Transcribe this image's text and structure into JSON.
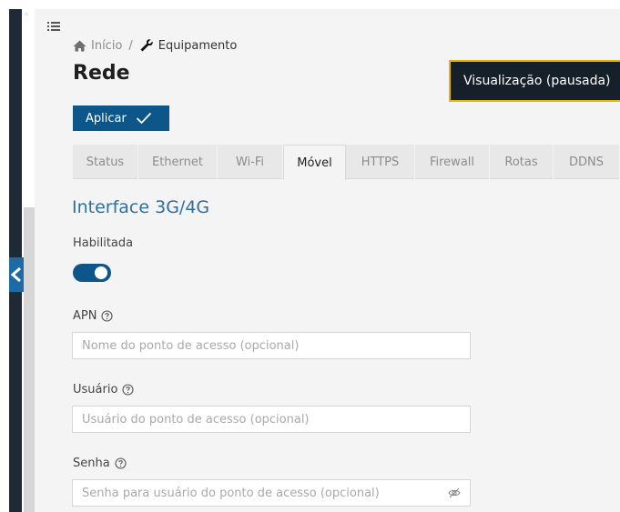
{
  "breadcrumb": {
    "home_label": "Início",
    "separator": "/",
    "current_label": "Equipamento"
  },
  "page": {
    "title": "Rede"
  },
  "preview_banner": {
    "label": "Visualização (pausada)",
    "border_color": "#e8b400"
  },
  "toolbar": {
    "apply_label": "Aplicar"
  },
  "tabs": [
    {
      "label": "Status",
      "active": false
    },
    {
      "label": "Ethernet",
      "active": false
    },
    {
      "label": "Wi-Fi",
      "active": false
    },
    {
      "label": "Móvel",
      "active": true
    },
    {
      "label": "HTTPS",
      "active": false
    },
    {
      "label": "Firewall",
      "active": false
    },
    {
      "label": "Rotas",
      "active": false
    },
    {
      "label": "DDNS",
      "active": false
    }
  ],
  "section": {
    "title": "Interface 3G/4G"
  },
  "form": {
    "enabled": {
      "label": "Habilitada",
      "value": true
    },
    "apn": {
      "label": "APN",
      "placeholder": "Nome do ponto de acesso (opcional)",
      "value": ""
    },
    "user": {
      "label": "Usuário",
      "placeholder": "Usuário do ponto de acesso (opcional)",
      "value": ""
    },
    "password": {
      "label": "Senha",
      "placeholder": "Senha para usuário do ponto de acesso (opcional)",
      "value": ""
    }
  },
  "icons": {
    "menu": "menu-icon",
    "home": "home-icon",
    "wrench": "wrench-icon",
    "check": "check-icon",
    "help": "help-circle-icon",
    "eye_off": "eye-off-icon",
    "collapse": "chevron-left-icon"
  },
  "colors": {
    "primary": "#0d5689",
    "section_title": "#2f6f9f",
    "sidebar": "#1e2a36",
    "banner_bg": "#15202b"
  }
}
